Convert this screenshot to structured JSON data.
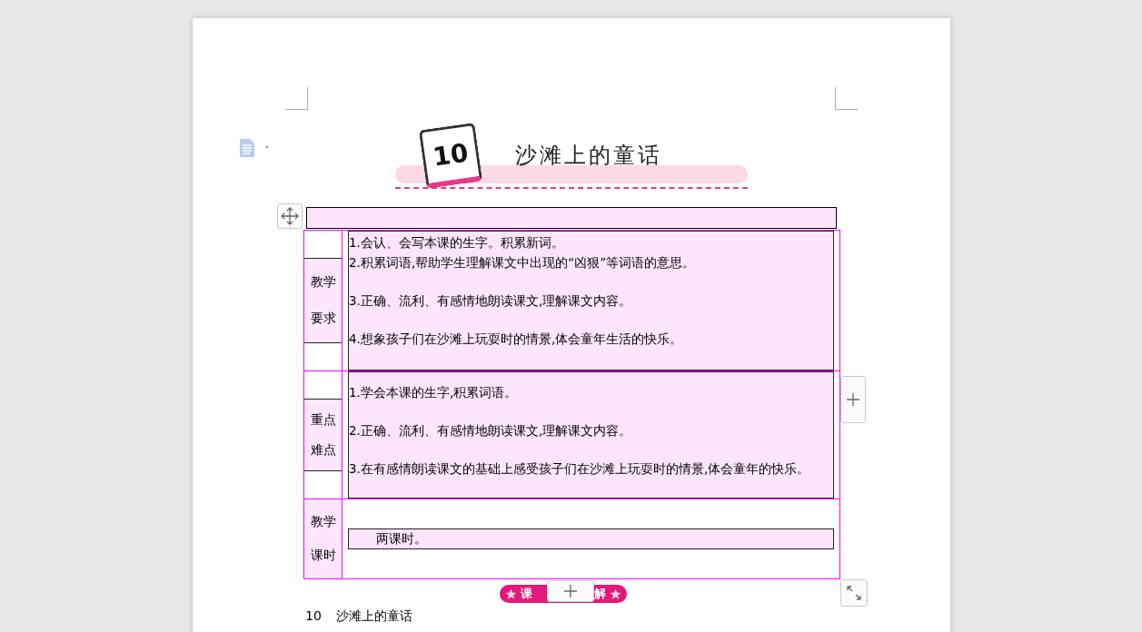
{
  "banner": {
    "lesson_number": "10",
    "title": "沙滩上的童话"
  },
  "table": {
    "rows": [
      {
        "kind": "list",
        "label": [
          "教学",
          "要求"
        ],
        "items": [
          "1.会认、会写本课的生字。积累新词。",
          "2.积累词语,帮助学生理解课文中出现的“凶狠”等词语的意思。",
          "3.正确、流利、有感情地朗读课文,理解课文内容。",
          "4.想象孩子们在沙滩上玩耍时的情景,体会童年生活的快乐。"
        ]
      },
      {
        "kind": "list",
        "label": [
          "重点",
          "难点"
        ],
        "items": [
          "1.学会本课的生字,积累词语。",
          "2.正确、流利、有感情地朗读课文,理解课文内容。",
          "3.在有感情朗读课文的基础上感受孩子们在沙滩上玩耍时的情景,体会童年的快乐。"
        ]
      },
      {
        "kind": "single",
        "label": [
          "教学",
          "课时"
        ],
        "items": [
          "两课时。"
        ]
      }
    ]
  },
  "badge": {
    "parts": [
      "课",
      "解"
    ]
  },
  "body": {
    "number": "10",
    "title": "沙滩上的童话"
  }
}
